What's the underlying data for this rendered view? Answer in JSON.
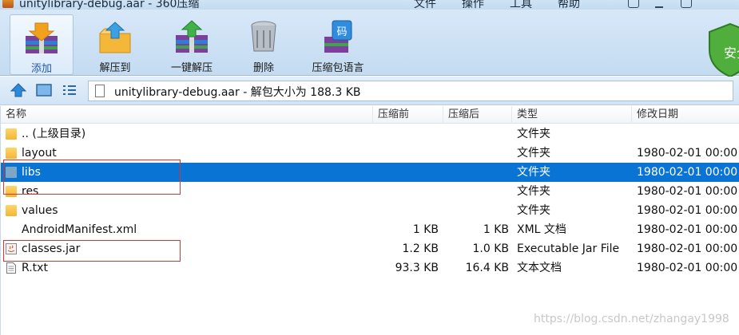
{
  "window": {
    "title": "unitylibrary-debug.aar - 360压缩",
    "menu": [
      "文件",
      "操作",
      "工具",
      "帮助"
    ]
  },
  "toolbar": {
    "buttons": [
      {
        "label": "添加",
        "icon": "add-archive-icon"
      },
      {
        "label": "解压到",
        "icon": "extract-to-icon"
      },
      {
        "label": "一键解压",
        "icon": "one-click-extract-icon"
      },
      {
        "label": "删除",
        "icon": "trash-icon"
      },
      {
        "label": "压缩包语言",
        "icon": "archive-language-icon"
      }
    ],
    "security_badge": "安全"
  },
  "address": {
    "text": "unitylibrary-debug.aar - 解包大小为 188.3 KB"
  },
  "columns": [
    "名称",
    "压缩前",
    "压缩后",
    "类型",
    "修改日期"
  ],
  "rows": [
    {
      "name": ".. (上级目录)",
      "before": "",
      "after": "",
      "type": "文件夹",
      "date": "",
      "icon": "folder-up-icon"
    },
    {
      "name": "layout",
      "before": "",
      "after": "",
      "type": "文件夹",
      "date": "1980-02-01 00:00",
      "icon": "folder-icon"
    },
    {
      "name": "libs",
      "before": "",
      "after": "",
      "type": "文件夹",
      "date": "1980-02-01 00:00",
      "icon": "folder-icon",
      "selected": true
    },
    {
      "name": "res",
      "before": "",
      "after": "",
      "type": "文件夹",
      "date": "1980-02-01 00:00",
      "icon": "folder-icon"
    },
    {
      "name": "values",
      "before": "",
      "after": "",
      "type": "文件夹",
      "date": "1980-02-01 00:00",
      "icon": "folder-icon"
    },
    {
      "name": "AndroidManifest.xml",
      "before": "1 KB",
      "after": "1 KB",
      "type": "XML 文档",
      "date": "1980-02-01 00:00",
      "icon": "xml-file-icon"
    },
    {
      "name": "classes.jar",
      "before": "1.2 KB",
      "after": "1.0 KB",
      "type": "Executable Jar File",
      "date": "1980-02-01 00:00",
      "icon": "jar-file-icon"
    },
    {
      "name": "R.txt",
      "before": "93.3 KB",
      "after": "16.4 KB",
      "type": "文本文档",
      "date": "1980-02-01 00:00",
      "icon": "text-file-icon"
    }
  ],
  "watermark": "https://blog.csdn.net/zhangay1998",
  "colors": {
    "selection": "#0a74d4",
    "highlight_box": "#e0332f",
    "toolbar": "#c4dbf1"
  }
}
